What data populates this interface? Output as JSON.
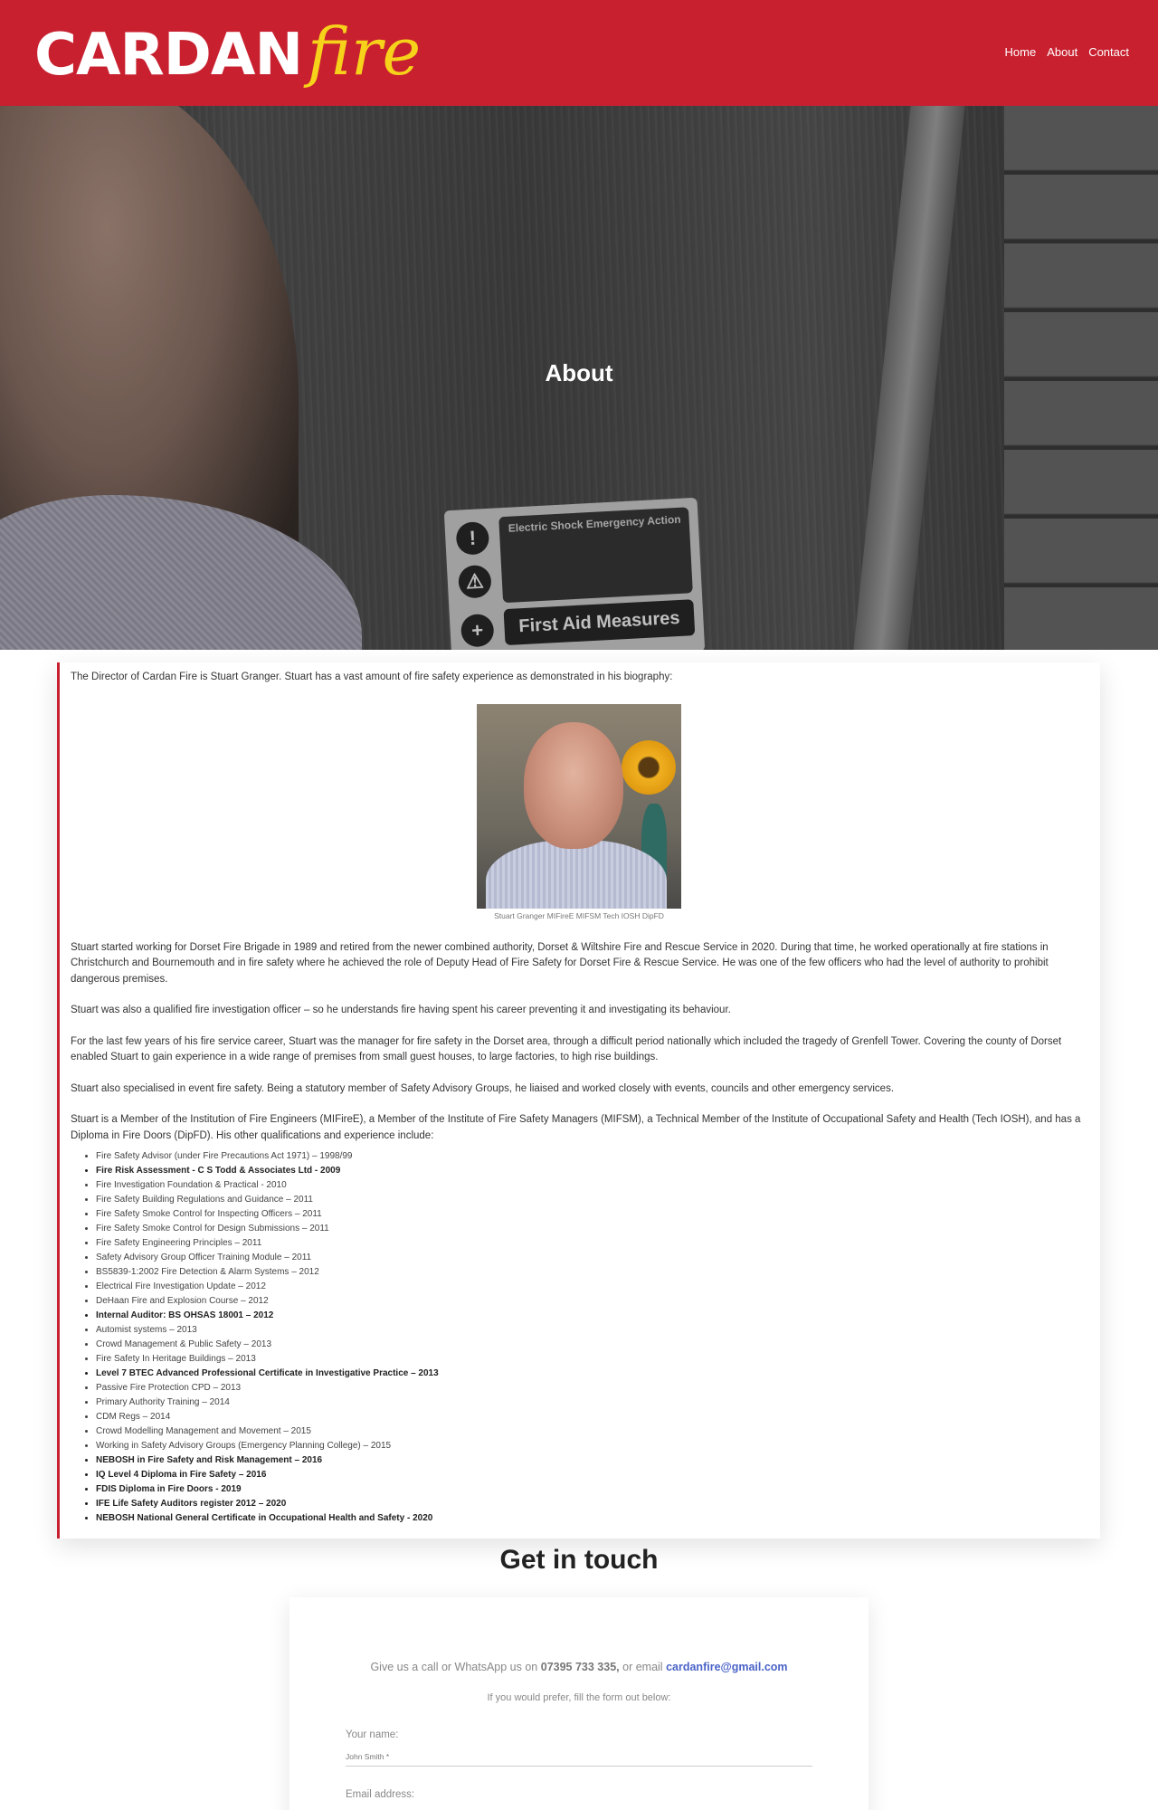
{
  "header": {
    "logo_main": "CARDAN",
    "logo_fire": "fire",
    "nav": [
      "Home",
      "About",
      "Contact"
    ]
  },
  "hero": {
    "title": "About",
    "sign_title": "Electric Shock Emergency Action",
    "sign_subtitle": "First Aid Measures"
  },
  "content": {
    "intro": "The Director of Cardan Fire is Stuart Granger. Stuart has a vast amount of fire safety experience as demonstrated in his biography:",
    "photo_caption": "Stuart Granger MIFireE MIFSM Tech IOSH DipFD",
    "paragraphs": [
      "Stuart started working for Dorset Fire Brigade in 1989 and retired from the newer combined authority, Dorset & Wiltshire Fire and Rescue Service in 2020. During that time, he worked operationally at fire stations in Christchurch and Bournemouth and in fire safety where he achieved the role of Deputy Head of Fire Safety for Dorset Fire & Rescue Service. He was one of the few officers who had the level of authority to prohibit dangerous premises.",
      "Stuart was also a qualified fire investigation officer – so he understands fire having spent his career preventing it and investigating its behaviour.",
      "For the last few years of his fire service career, Stuart was the manager for fire safety in the Dorset area, through a difficult period nationally which included the tragedy of Grenfell Tower. Covering the county of Dorset enabled Stuart to gain experience in a wide range of premises from small guest houses, to large factories, to high rise buildings.",
      "Stuart also specialised in event fire safety. Being a statutory member of Safety Advisory Groups, he liaised and worked closely with events, councils and other emergency services.",
      "Stuart is a Member of the Institution of Fire Engineers (MIFireE), a Member of the Institute of Fire Safety Managers (MIFSM), a Technical Member of the Institute of Occupational Safety and Health (Tech IOSH), and has a Diploma in Fire Doors (DipFD). His other qualifications and experience include:"
    ],
    "qualifications": [
      {
        "text": "Fire Safety Advisor (under Fire Precautions Act 1971) – 1998/99",
        "bold": false
      },
      {
        "text": "Fire Risk Assessment - C S Todd & Associates Ltd - 2009",
        "bold": true
      },
      {
        "text": "Fire Investigation Foundation & Practical - 2010",
        "bold": false
      },
      {
        "text": "Fire Safety Building Regulations and Guidance – 2011",
        "bold": false
      },
      {
        "text": "Fire Safety Smoke Control for Inspecting Officers – 2011",
        "bold": false
      },
      {
        "text": "Fire Safety Smoke Control for Design Submissions – 2011",
        "bold": false
      },
      {
        "text": "Fire Safety Engineering Principles – 2011",
        "bold": false
      },
      {
        "text": "Safety Advisory Group Officer Training Module – 2011",
        "bold": false
      },
      {
        "text": "BS5839-1:2002 Fire Detection & Alarm Systems – 2012",
        "bold": false
      },
      {
        "text": "Electrical Fire Investigation Update – 2012",
        "bold": false
      },
      {
        "text": "DeHaan Fire and Explosion Course – 2012",
        "bold": false
      },
      {
        "text": "Internal Auditor: BS OHSAS 18001 – 2012",
        "bold": true
      },
      {
        "text": "Automist systems – 2013",
        "bold": false
      },
      {
        "text": "Crowd Management & Public Safety – 2013",
        "bold": false
      },
      {
        "text": "Fire Safety In Heritage Buildings – 2013",
        "bold": false
      },
      {
        "text": "Level 7 BTEC Advanced Professional Certificate in Investigative Practice – 2013",
        "bold": true
      },
      {
        "text": "Passive Fire Protection CPD – 2013",
        "bold": false
      },
      {
        "text": "Primary Authority Training – 2014",
        "bold": false
      },
      {
        "text": "CDM Regs – 2014",
        "bold": false
      },
      {
        "text": "Crowd Modelling Management and Movement – 2015",
        "bold": false
      },
      {
        "text": "Working in Safety Advisory Groups (Emergency Planning College) – 2015",
        "bold": false
      },
      {
        "text": "NEBOSH in Fire Safety and Risk Management – 2016",
        "bold": true
      },
      {
        "text": "IQ Level 4 Diploma in Fire Safety – 2016",
        "bold": true
      },
      {
        "text": "FDIS Diploma in Fire Doors - 2019",
        "bold": true
      },
      {
        "text": "IFE Life Safety Auditors register 2012 – 2020",
        "bold": true
      },
      {
        "text": "NEBOSH National General Certificate in Occupational Health and Safety - 2020",
        "bold": true
      }
    ]
  },
  "contact": {
    "title": "Get in touch",
    "call_prefix": "Give us a call or WhatsApp us on",
    "phone": "07395 733 335,",
    "email_prefix": "or email",
    "email": "cardanfire@gmail.com",
    "prefer_text": "If you would prefer, fill the form out below:",
    "name_label": "Your name:",
    "name_placeholder": "John Smith *",
    "email_label": "Email address:"
  },
  "colors": {
    "brand_red": "#c8202f",
    "logo_yellow": "#f7d21a",
    "link_blue": "#4a63c8"
  }
}
